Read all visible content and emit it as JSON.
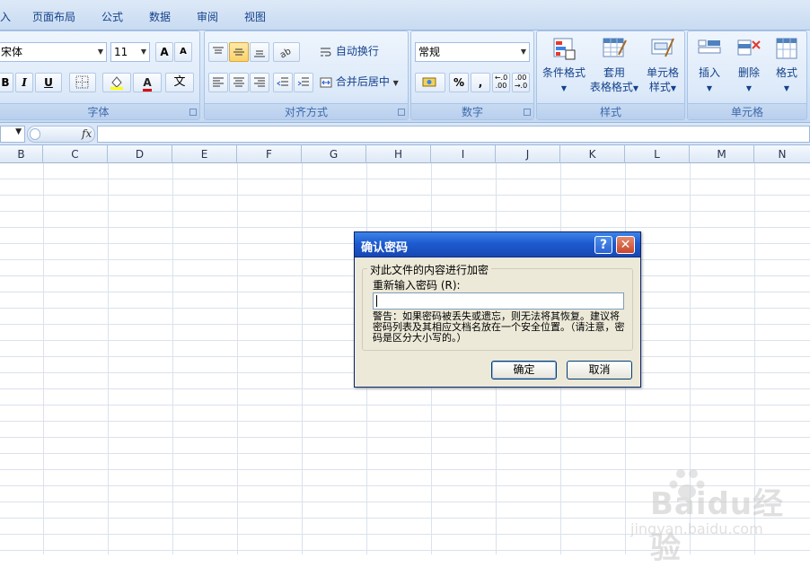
{
  "ribbon_tabs": [
    "入",
    "页面布局",
    "公式",
    "数据",
    "审阅",
    "视图"
  ],
  "font_group": {
    "font_name": "宋体",
    "font_size": "11",
    "grow_label": "A",
    "shrink_label": "A",
    "bold": "B",
    "italic": "I",
    "underline": "U",
    "font_color_label": "A",
    "phonetic_label": "文",
    "group_label": "字体"
  },
  "align_group": {
    "wrap_text": "自动换行",
    "merge_center": "合并后居中",
    "group_label": "对齐方式"
  },
  "number_group": {
    "format": "常规",
    "percent": "%",
    "comma": ",",
    "inc_decimal": "+.0\n.00",
    "dec_decimal": ".00\n→.0",
    "group_label": "数字"
  },
  "styles_group": {
    "conditional": "条件格式",
    "table_format_1": "套用",
    "table_format_2": "表格格式",
    "cell_styles_1": "单元格",
    "cell_styles_2": "样式",
    "group_label": "样式"
  },
  "cells_group": {
    "insert": "插入",
    "delete": "删除",
    "format": "格式",
    "group_label": "单元格"
  },
  "formula_bar": {
    "fx": "fx"
  },
  "columns": [
    "B",
    "C",
    "D",
    "E",
    "F",
    "G",
    "H",
    "I",
    "J",
    "K",
    "L",
    "M",
    "N"
  ],
  "dialog": {
    "title": "确认密码",
    "help": "?",
    "close": "✕",
    "group_title": "对此文件的内容进行加密",
    "field_label": "重新输入密码 (R):",
    "password_value": "",
    "warning": "警告：如果密码被丢失或遗忘，则无法将其恢复。建议将密码列表及其相应文档名放在一个安全位置。（请注意，密码是区分大小写的。）",
    "ok": "确定",
    "cancel": "取消"
  },
  "watermark": {
    "text": "Baidu经验",
    "sub": "jingyan.baidu.com"
  }
}
